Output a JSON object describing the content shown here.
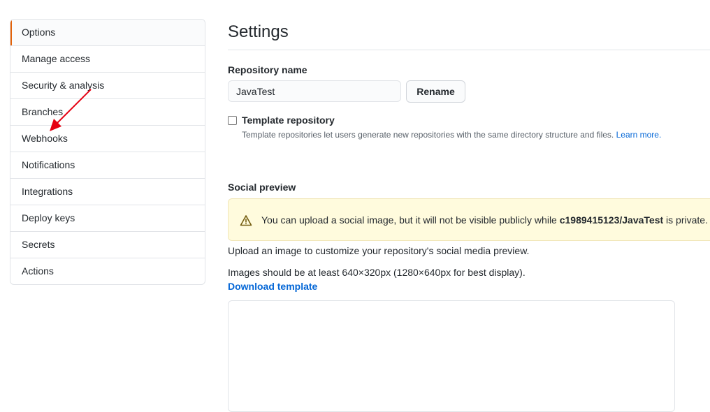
{
  "sidebar": {
    "items": [
      {
        "label": "Options",
        "selected": true
      },
      {
        "label": "Manage access"
      },
      {
        "label": "Security & analysis"
      },
      {
        "label": "Branches"
      },
      {
        "label": "Webhooks"
      },
      {
        "label": "Notifications"
      },
      {
        "label": "Integrations"
      },
      {
        "label": "Deploy keys"
      },
      {
        "label": "Secrets"
      },
      {
        "label": "Actions"
      }
    ]
  },
  "main": {
    "title": "Settings",
    "repository_name_label": "Repository name",
    "repository_name_value": "JavaTest",
    "rename_label": "Rename",
    "template": {
      "label": "Template repository",
      "checked": false,
      "description": "Template repositories let users generate new repositories with the same directory structure and files.",
      "link": "Learn more."
    },
    "social_preview": {
      "heading": "Social preview",
      "warning_prefix": "You can upload a social image, but it will not be visible publicly while ",
      "warning_repo": "c1989415123/JavaTest",
      "warning_suffix": " is private.",
      "upload_text": "Upload an image to customize your repository's social media preview.",
      "size_text": "Images should be at least 640×320px (1280×640px for best display).",
      "download_link": "Download template"
    }
  },
  "colors": {
    "accent_selected": "#e36209",
    "link": "#0366d6",
    "warning_bg": "#fffbdd",
    "annotation_arrow": "#e60012"
  },
  "icons": [
    "alert-icon",
    "annotation-arrow"
  ]
}
